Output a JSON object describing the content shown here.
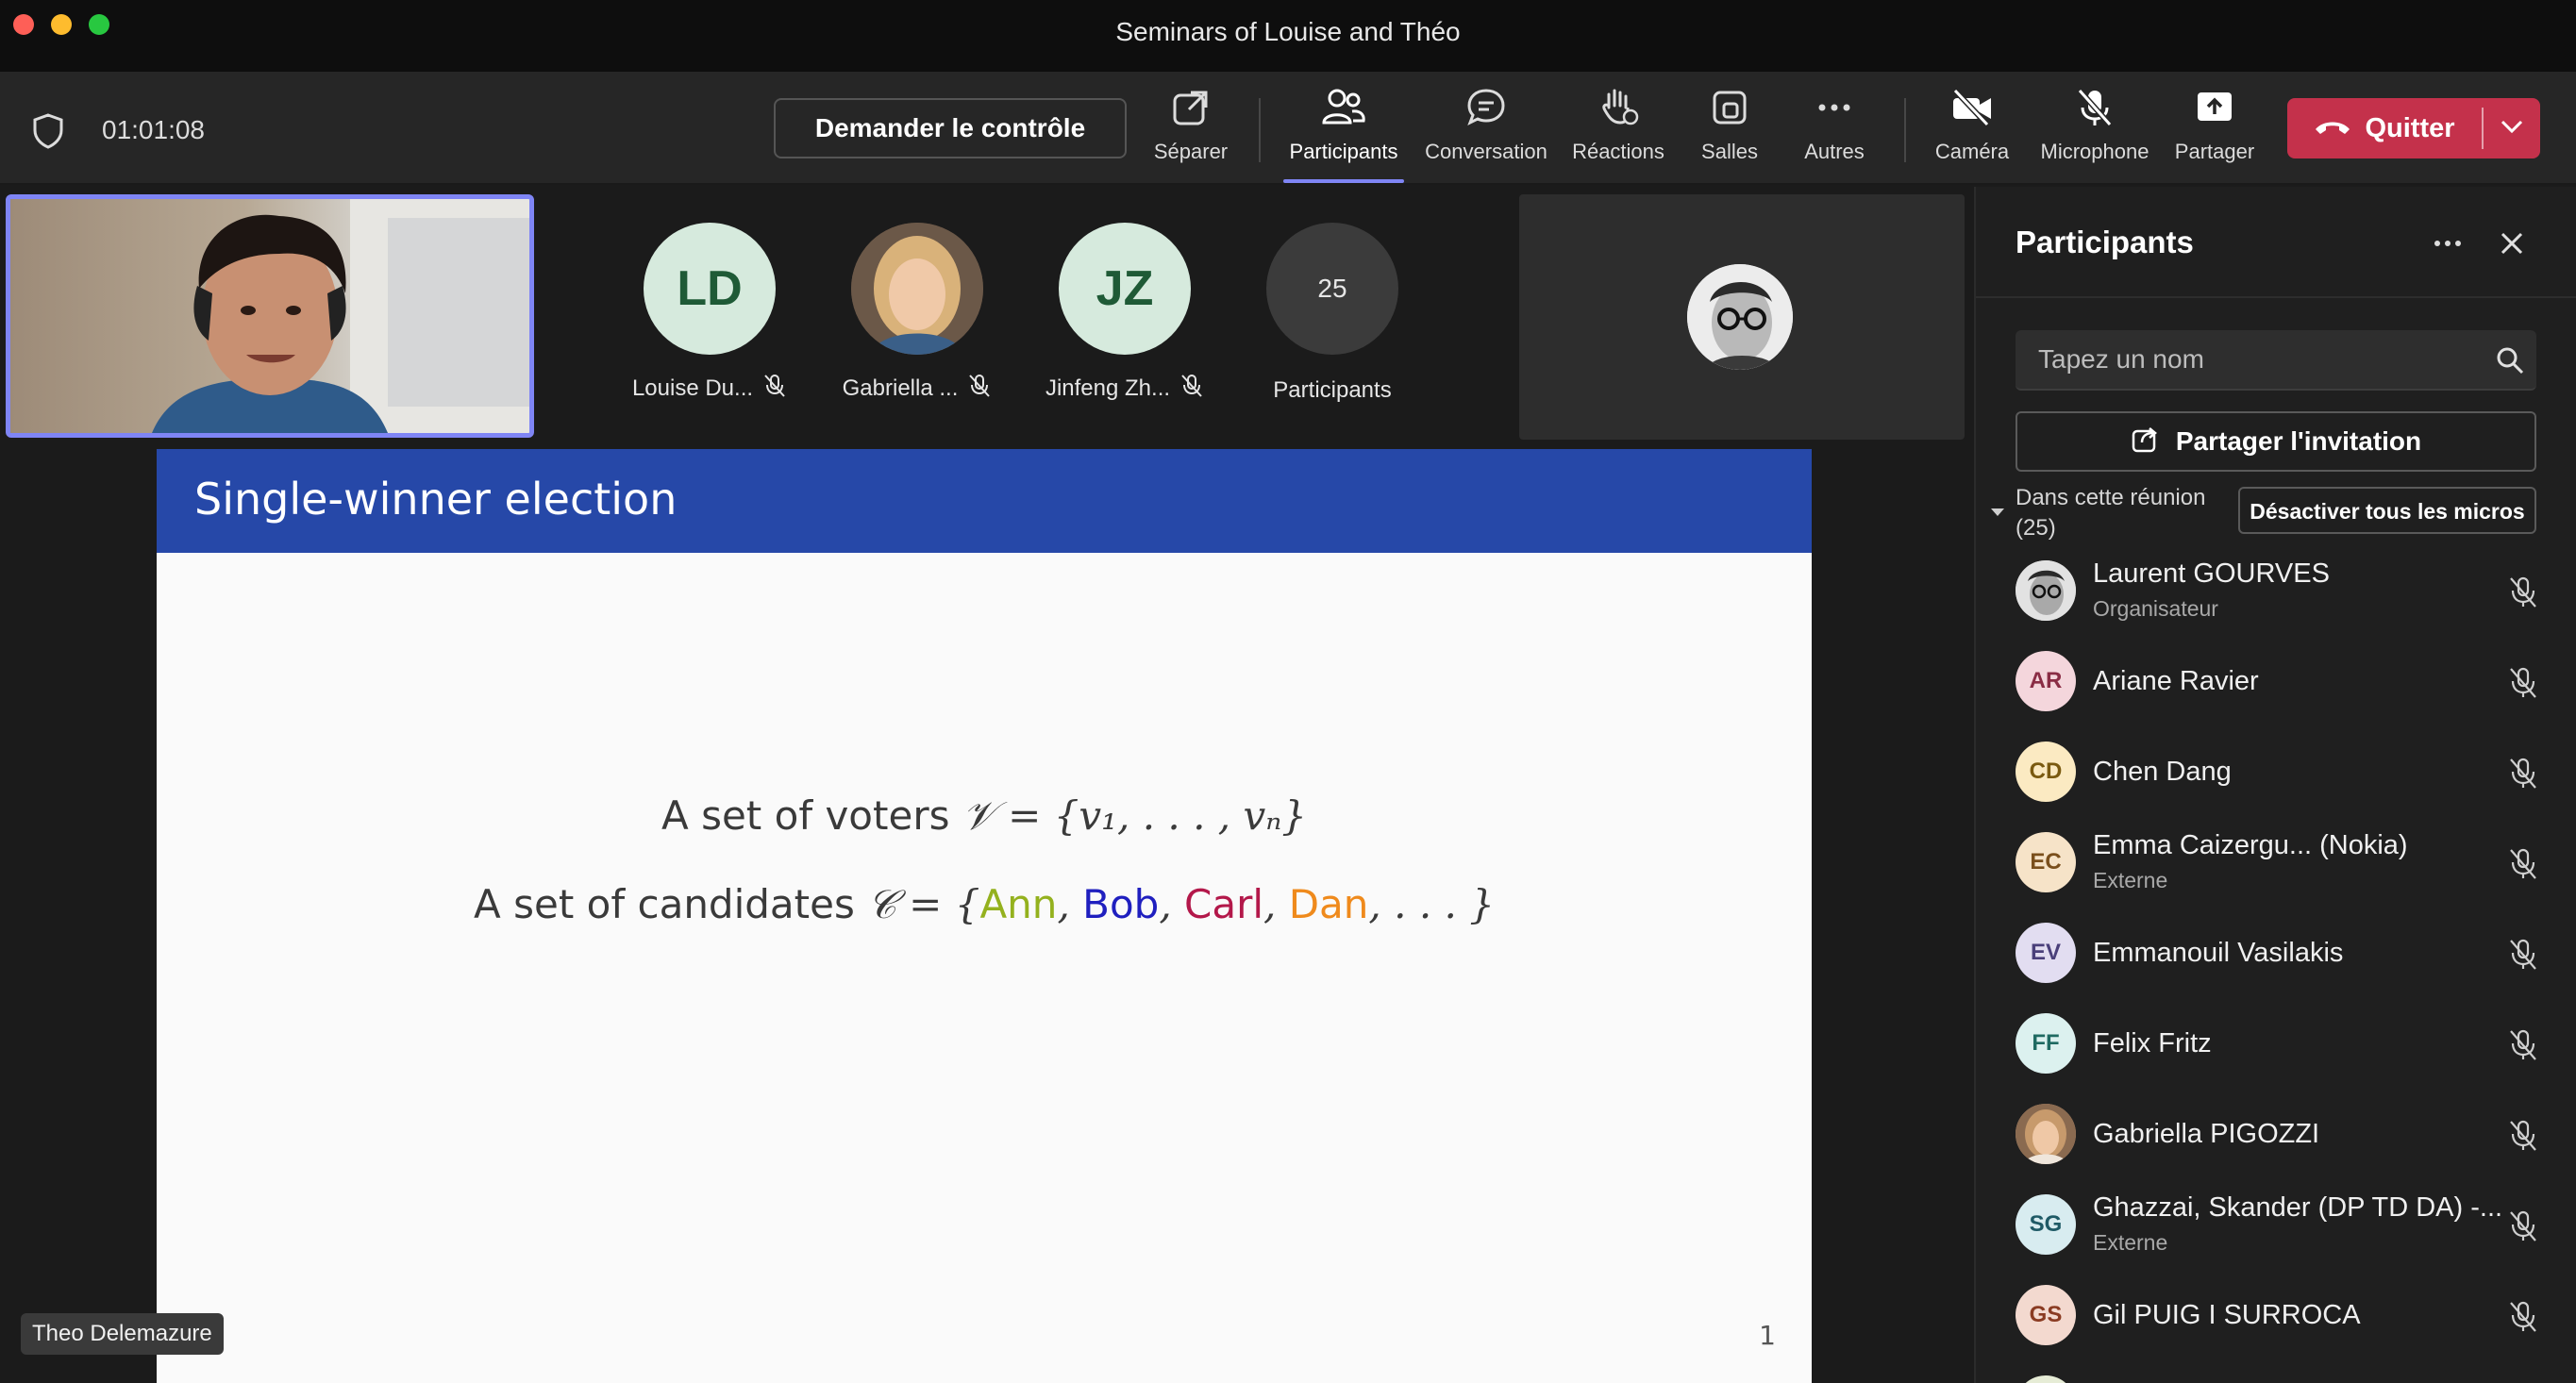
{
  "window": {
    "title": "Seminars of Louise and Théo",
    "traffic_colors": [
      "#fe5f57",
      "#febc2e",
      "#28c840"
    ]
  },
  "toolbar": {
    "timer": "01:01:08",
    "request_control": "Demander le contrôle",
    "items": {
      "separate": "Séparer",
      "participants": "Participants",
      "chat": "Conversation",
      "reactions": "Réactions",
      "rooms": "Salles",
      "more": "Autres",
      "camera": "Caméra",
      "microphone": "Microphone",
      "share": "Partager"
    },
    "quit": "Quitter",
    "accent": "#7f85f5",
    "quit_color": "#c4314b"
  },
  "stage": {
    "roster": [
      {
        "initials": "LD",
        "name": "Louise Du...",
        "muted": true
      },
      {
        "initials": "",
        "name": "Gabriella ...",
        "muted": true
      },
      {
        "initials": "JZ",
        "name": "Jinfeng Zh...",
        "muted": true
      }
    ],
    "overflow": {
      "count": "25",
      "label": "Participants"
    },
    "active_speaker": "Theo Delemazure"
  },
  "slide": {
    "title": "Single-winner election",
    "voters_text": "A set of voters",
    "voters_math": "𝒱 = {v₁, . . . , vₙ}",
    "candidates_text": "A set of candidates",
    "candidates_math": "𝒞 = {",
    "candidates": [
      {
        "name": "Ann",
        "color": "#94b11e"
      },
      {
        "name": "Bob",
        "color": "#1f1fbf"
      },
      {
        "name": "Carl",
        "color": "#b3184a"
      },
      {
        "name": "Dan",
        "color": "#ef8a1c"
      }
    ],
    "candidates_tail": ", . . . }",
    "page": "1",
    "header_color": "#2648a8"
  },
  "panel": {
    "title": "Participants",
    "search_placeholder": "Tapez un nom",
    "invite": "Partager l'invitation",
    "section_label": "Dans cette réunion (25)",
    "mute_all": "Désactiver tous les micros",
    "participants": [
      {
        "initials": "",
        "name": "Laurent GOURVES",
        "role": "Organisateur",
        "avatar": "photo",
        "bg": "#cfcfcf",
        "fg": "#333333"
      },
      {
        "initials": "AR",
        "name": "Ariane Ravier",
        "role": "",
        "avatar": "initials",
        "bg": "#f4d6dc",
        "fg": "#8a2d45"
      },
      {
        "initials": "CD",
        "name": "Chen Dang",
        "role": "",
        "avatar": "initials",
        "bg": "#fbeac2",
        "fg": "#7a5a10"
      },
      {
        "initials": "EC",
        "name": "Emma Caizergu... (Nokia)",
        "role": "Externe",
        "avatar": "initials",
        "bg": "#f6e3c8",
        "fg": "#7a4f1c"
      },
      {
        "initials": "EV",
        "name": "Emmanouil Vasilakis",
        "role": "",
        "avatar": "initials",
        "bg": "#e2ddf1",
        "fg": "#4a3f7a"
      },
      {
        "initials": "FF",
        "name": "Felix Fritz",
        "role": "",
        "avatar": "initials",
        "bg": "#dcf1ef",
        "fg": "#1f6a62"
      },
      {
        "initials": "",
        "name": "Gabriella PIGOZZI",
        "role": "",
        "avatar": "photo",
        "bg": "#caa283",
        "fg": "#5a3a24"
      },
      {
        "initials": "SG",
        "name": "Ghazzai, Skander (DP TD DA) -...",
        "role": "Externe",
        "avatar": "initials",
        "bg": "#d8ecf0",
        "fg": "#1f5a66"
      },
      {
        "initials": "GS",
        "name": "Gil PUIG I SURROCA",
        "role": "",
        "avatar": "initials",
        "bg": "#f3d9cf",
        "fg": "#8a3b22"
      }
    ]
  }
}
